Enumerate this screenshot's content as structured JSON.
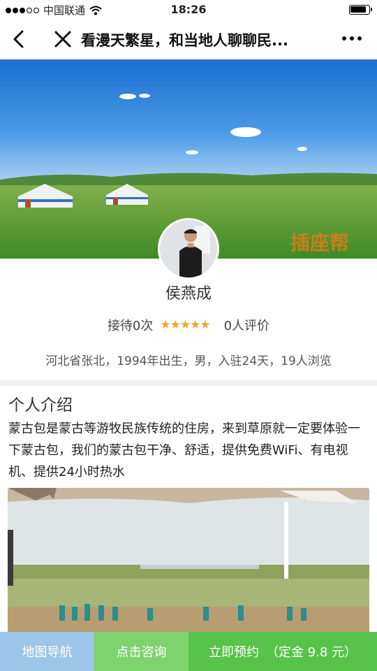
{
  "status_bar": {
    "carrier": "中国联通",
    "time": "18:26"
  },
  "nav": {
    "title": "看漫天繁星，和当地人聊聊民..."
  },
  "host": {
    "name": "侯燕成",
    "reception": "接待0次",
    "stars": "★★★★★",
    "reviews": "0人评价",
    "meta": "河北省张北，1994年出生，男，入驻24天，19人浏览"
  },
  "intro": {
    "title": "个人介绍",
    "text": "蒙古包是蒙古等游牧民族传统的住房，来到草原就一定要体验一下蒙古包，我们的蒙古包干净、舒适，提供免费WiFi、有电视机、提供24小时热水"
  },
  "bottom_bar": {
    "map_label": "地图导航",
    "consult_label": "点击咨询",
    "book_label": "立即预约",
    "price_label": "（定金 9.8 元）"
  },
  "colors": {
    "map_button": "#9bc6ea",
    "consult_button": "#7ed36f",
    "book_button": "#58c24a",
    "star": "#f5a623"
  },
  "icons": [
    "back-icon",
    "close-icon",
    "more-icon",
    "wifi-icon",
    "battery-icon",
    "star-icon"
  ]
}
